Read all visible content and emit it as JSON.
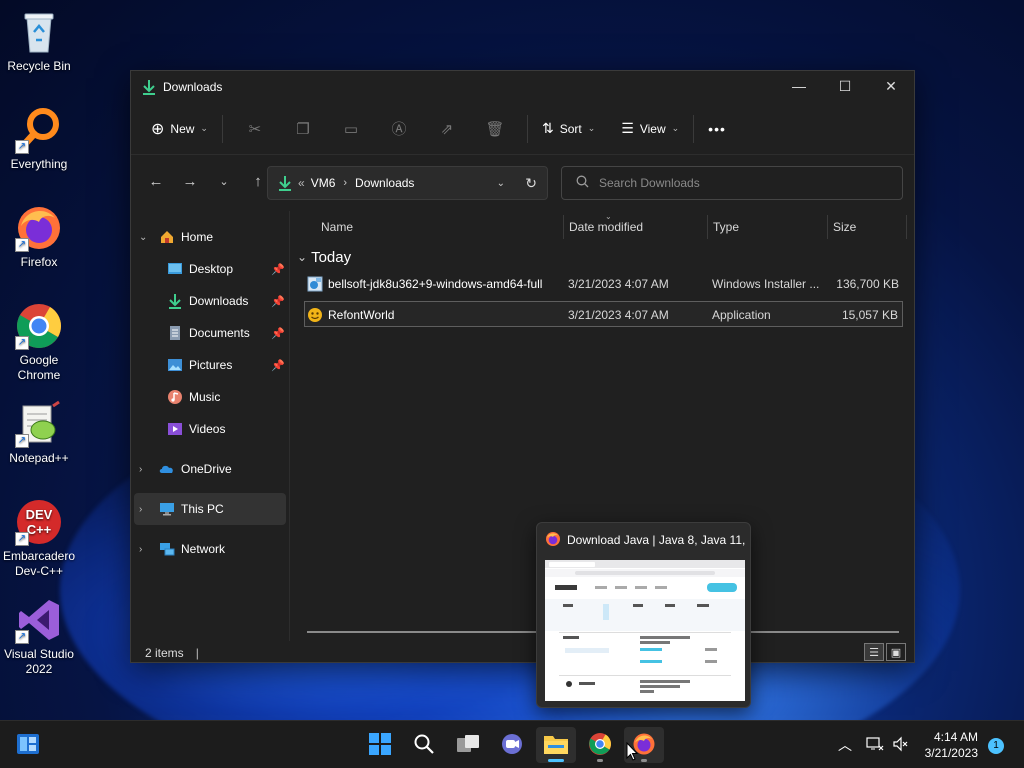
{
  "desktop": {
    "icons": [
      {
        "label": "Recycle Bin",
        "icon": "recycle-bin-icon"
      },
      {
        "label": "Everything",
        "icon": "everything-search-icon"
      },
      {
        "label": "Firefox",
        "icon": "firefox-icon"
      },
      {
        "label": "Google Chrome",
        "icon": "chrome-icon"
      },
      {
        "label": "Notepad++",
        "icon": "notepadpp-icon"
      },
      {
        "label": "Embarcadero Dev-C++",
        "icon": "devcpp-icon"
      },
      {
        "label": "Visual Studio 2022",
        "icon": "visual-studio-icon"
      }
    ]
  },
  "window": {
    "title": "Downloads",
    "toolbar": {
      "new_label": "New",
      "sort_label": "Sort",
      "view_label": "View",
      "more_label": "•••"
    },
    "address": {
      "overflow": "«",
      "segments": [
        "VM6",
        "Downloads"
      ]
    },
    "search_placeholder": "Search Downloads",
    "nav": {
      "home": "Home",
      "quick": [
        {
          "label": "Desktop",
          "icon": "desktop-folder-icon"
        },
        {
          "label": "Downloads",
          "icon": "downloads-folder-icon"
        },
        {
          "label": "Documents",
          "icon": "documents-folder-icon"
        },
        {
          "label": "Pictures",
          "icon": "pictures-folder-icon"
        },
        {
          "label": "Music",
          "icon": "music-folder-icon"
        },
        {
          "label": "Videos",
          "icon": "videos-folder-icon"
        }
      ],
      "onedrive": "OneDrive",
      "this_pc": "This PC",
      "network": "Network"
    },
    "columns": {
      "name": "Name",
      "date": "Date modified",
      "type": "Type",
      "size": "Size"
    },
    "group_label": "Today",
    "files": [
      {
        "name": "bellsoft-jdk8u362+9-windows-amd64-full",
        "date": "3/21/2023 4:07 AM",
        "type": "Windows Installer ...",
        "size": "136,700 KB"
      },
      {
        "name": "RefontWorld",
        "date": "3/21/2023 4:07 AM",
        "type": "Application",
        "size": "15,057 KB"
      }
    ],
    "status": {
      "count": "2 items",
      "divider": "|"
    }
  },
  "thumbnail": {
    "title": "Download Java | Java 8, Java 11,..."
  },
  "taskbar": {
    "clock_time": "4:14 AM",
    "clock_date": "3/21/2023",
    "notification_count": "1"
  },
  "colors": {
    "accent": "#4cc2ff",
    "window_bg": "#202020",
    "taskbar_bg": "#1c1c1c"
  }
}
